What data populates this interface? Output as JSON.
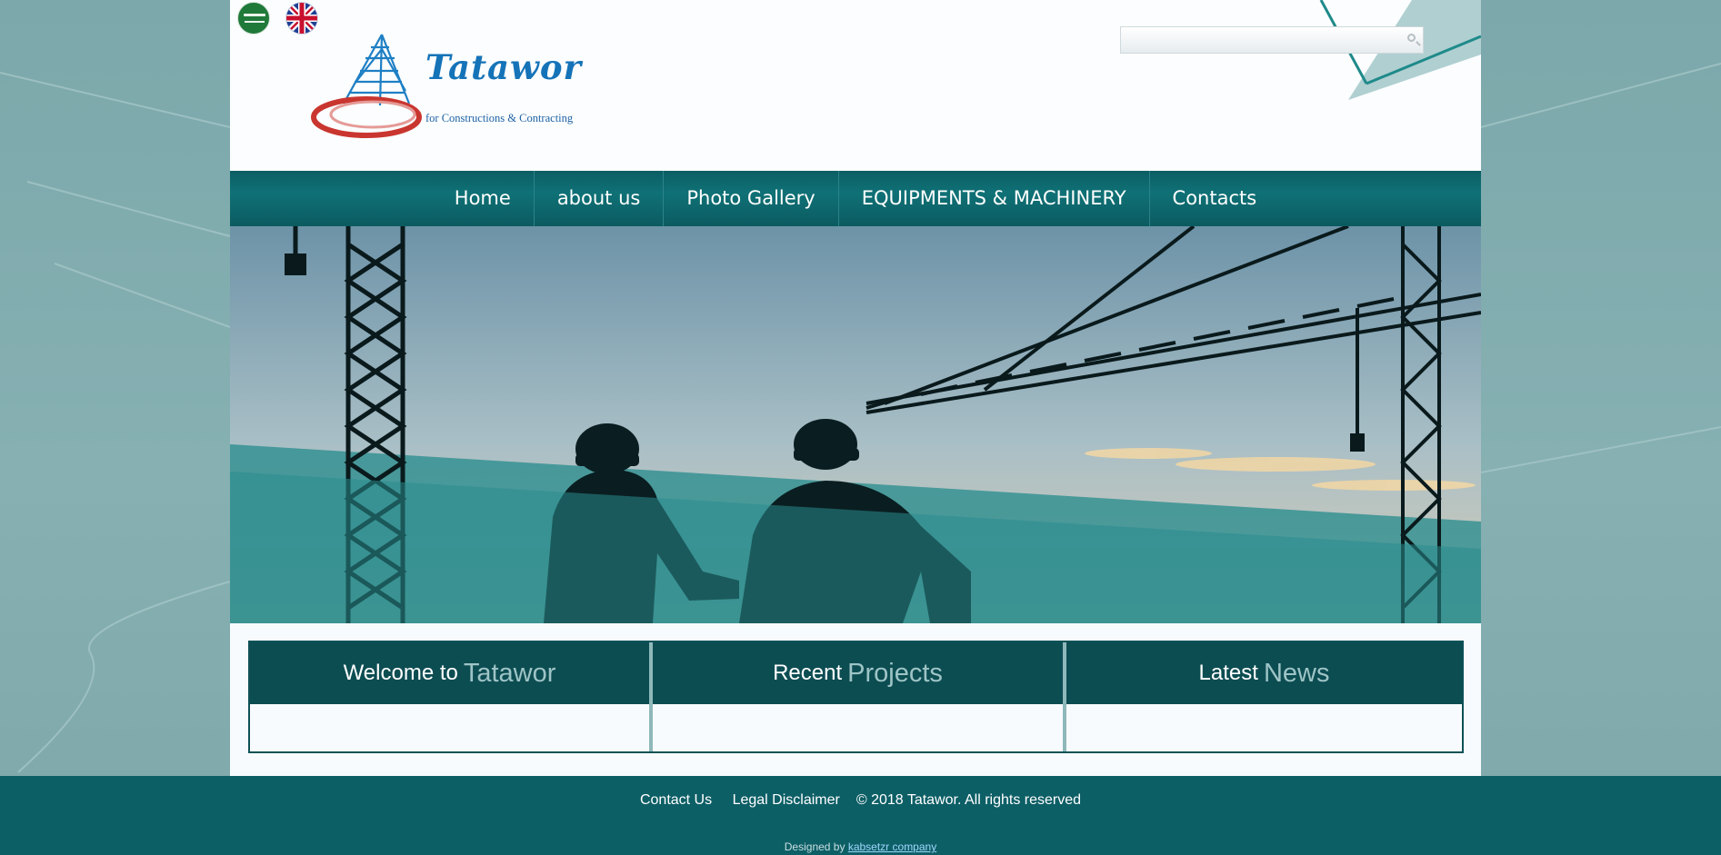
{
  "language_flags": [
    {
      "name": "arabic"
    },
    {
      "name": "english"
    }
  ],
  "logo": {
    "title": "Tatawor",
    "subtitle": "for Constructions & Contracting"
  },
  "search": {
    "value": "",
    "placeholder": ""
  },
  "nav": {
    "items": [
      "Home",
      "about us",
      "Photo Gallery",
      "EQUIPMENTS & MACHINERY",
      "Contacts"
    ]
  },
  "panels": [
    {
      "lead": "Welcome to",
      "accent": "Tatawor"
    },
    {
      "lead": "Recent",
      "accent": "Projects"
    },
    {
      "lead": "Latest",
      "accent": "News"
    }
  ],
  "footer": {
    "contact": "Contact Us",
    "legal": "Legal Disclaimer",
    "copyright": "© 2018 Tatawor. All rights reserved",
    "designed_by": "Designed by",
    "designer": "kabsetzr company"
  },
  "colors": {
    "nav_bg": "#0f7176",
    "panel_head": "#0c4d52",
    "footer_bg": "#0d5f66",
    "brand_blue": "#1573b8",
    "page_bg": "#7ca8ab"
  }
}
